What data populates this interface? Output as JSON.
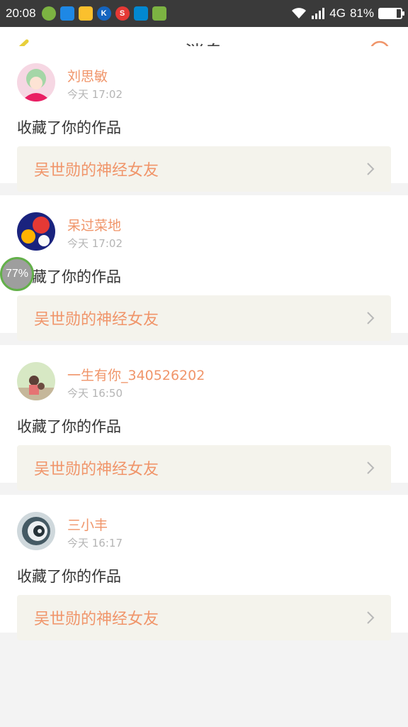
{
  "status_bar": {
    "time": "20:08",
    "network": "4G",
    "battery": "81%",
    "battery_level": 0.81,
    "app_icons": [
      "app-icon-1",
      "app-icon-2",
      "app-icon-3",
      "app-icon-4",
      "app-icon-5",
      "app-icon-6",
      "android-icon"
    ]
  },
  "header": {
    "title": "消息"
  },
  "colors": {
    "accent": "#f0956a",
    "back_icon": "#e8cf3a"
  },
  "messages": [
    {
      "user": "刘思敏",
      "time": "今天 17:02",
      "action": "收藏了你的作品",
      "work": "吴世勋的神经女友"
    },
    {
      "user": "呆过菜地",
      "time": "今天 17:02",
      "action": "收藏了你的作品",
      "work": "吴世勋的神经女友"
    },
    {
      "user": "一生有你_340526202",
      "time": "今天 16:50",
      "action": "收藏了你的作品",
      "work": "吴世勋的神经女友"
    },
    {
      "user": "三小丰",
      "time": "今天 16:17",
      "action": "收藏了你的作品",
      "work": "吴世勋的神经女友"
    }
  ],
  "floating_badge": {
    "text": "77%"
  }
}
